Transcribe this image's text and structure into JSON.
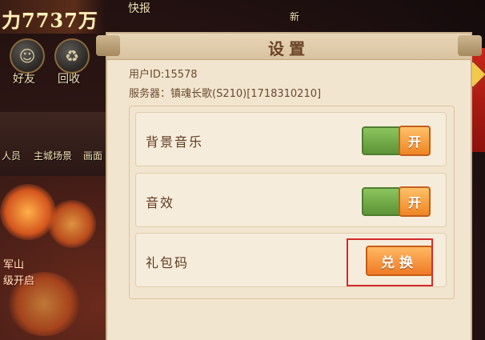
{
  "hud": {
    "power": "力7737万",
    "top_buttons": [
      "快报",
      "新"
    ],
    "round_buttons": [
      {
        "label": "好友",
        "icon": "friends-icon"
      },
      {
        "label": "回收",
        "icon": "recycle-icon"
      }
    ],
    "side_labels": [
      "人员",
      "主城场景",
      "画面"
    ],
    "event_labels": [
      "军山",
      "级开启"
    ]
  },
  "settings": {
    "title": "设置",
    "user_id": "用户ID:15578",
    "server": "服务器：镇魂长歌(S210)[1718310210]",
    "rows": [
      {
        "label": "背景音乐",
        "control": "toggle",
        "state": "开"
      },
      {
        "label": "音效",
        "control": "toggle",
        "state": "开"
      },
      {
        "label": "礼包码",
        "control": "button",
        "button_label": "兑换"
      }
    ]
  },
  "colors": {
    "toggle_on": "#6fa94a",
    "button_orange": "#f07a25",
    "highlight": "#d42b2b",
    "panel_bg": "#f2e5cf"
  }
}
